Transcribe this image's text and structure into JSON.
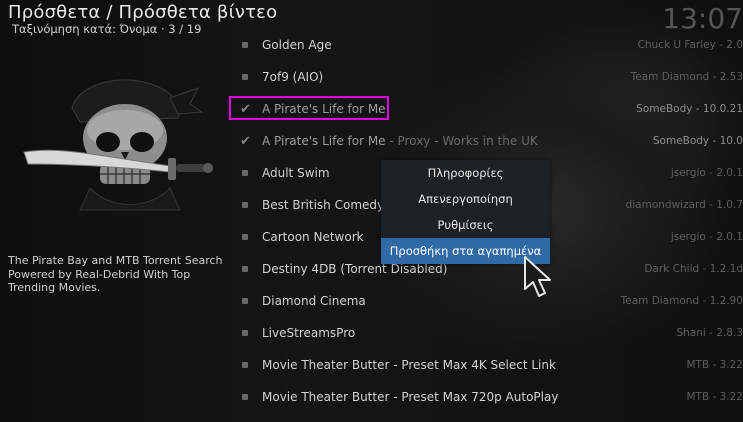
{
  "header": {
    "title": "Πρόσθετα / Πρόσθετα βίντεο",
    "sort_info": "Ταξινόμηση κατά: Όνομα  ·  3 / 19",
    "clock": "13:07"
  },
  "addon_info": {
    "description": "The Pirate Bay and MTB Torrent Search Powered by Real-Debrid With Top Trending Movies."
  },
  "list": [
    {
      "name": "Golden Age",
      "extra": "",
      "right": "Chuck U Farley - 2.0",
      "marker": "bullet"
    },
    {
      "name": "7of9 (AIO)",
      "extra": "",
      "right": "Team Diamond - 2.53",
      "marker": "bullet"
    },
    {
      "name": "A Pirate's Life for Me",
      "extra": "",
      "right": "SomeBody - 10.0.21",
      "marker": "check"
    },
    {
      "name": "A Pirate's Life for Me",
      "extra": " - Proxy - Works in the UK",
      "right": "SomeBody - 10.0",
      "marker": "check"
    },
    {
      "name": "Adult Swim",
      "extra": "",
      "right": "jsergio - 2.0.1",
      "marker": "bullet"
    },
    {
      "name": "Best British Comedy",
      "extra": "",
      "right": "diamondwizard - 1.0.7",
      "marker": "bullet"
    },
    {
      "name": "Cartoon Network",
      "extra": "",
      "right": "jsergio - 2.0.1",
      "marker": "bullet"
    },
    {
      "name": "Destiny 4DB (Torrent Disabled)",
      "extra": "",
      "right": "Dark Child - 1.2.1d",
      "marker": "bullet"
    },
    {
      "name": "Diamond Cinema",
      "extra": "",
      "right": "Team Diamond - 1.2.90",
      "marker": "bullet"
    },
    {
      "name": "LiveStreamsPro",
      "extra": "",
      "right": "Shani - 2.8.3",
      "marker": "bullet"
    },
    {
      "name": "Movie Theater Butter - Preset Max 4K Select Link",
      "extra": "",
      "right": "MTB - 3.22",
      "marker": "bullet"
    },
    {
      "name": "Movie Theater Butter - Preset Max 720p AutoPlay",
      "extra": "",
      "right": "MTB - 3.22",
      "marker": "bullet"
    }
  ],
  "context_menu": {
    "items": [
      "Πληροφορίες",
      "Απενεργοποίηση",
      "Ρυθμίσεις",
      "Προσθήκη στα αγαπημένα"
    ],
    "active_index": 3
  },
  "colors": {
    "highlight_box": "#e400e4",
    "menu_active": "#2f6aa6",
    "menu_bg": "#1d2226"
  }
}
